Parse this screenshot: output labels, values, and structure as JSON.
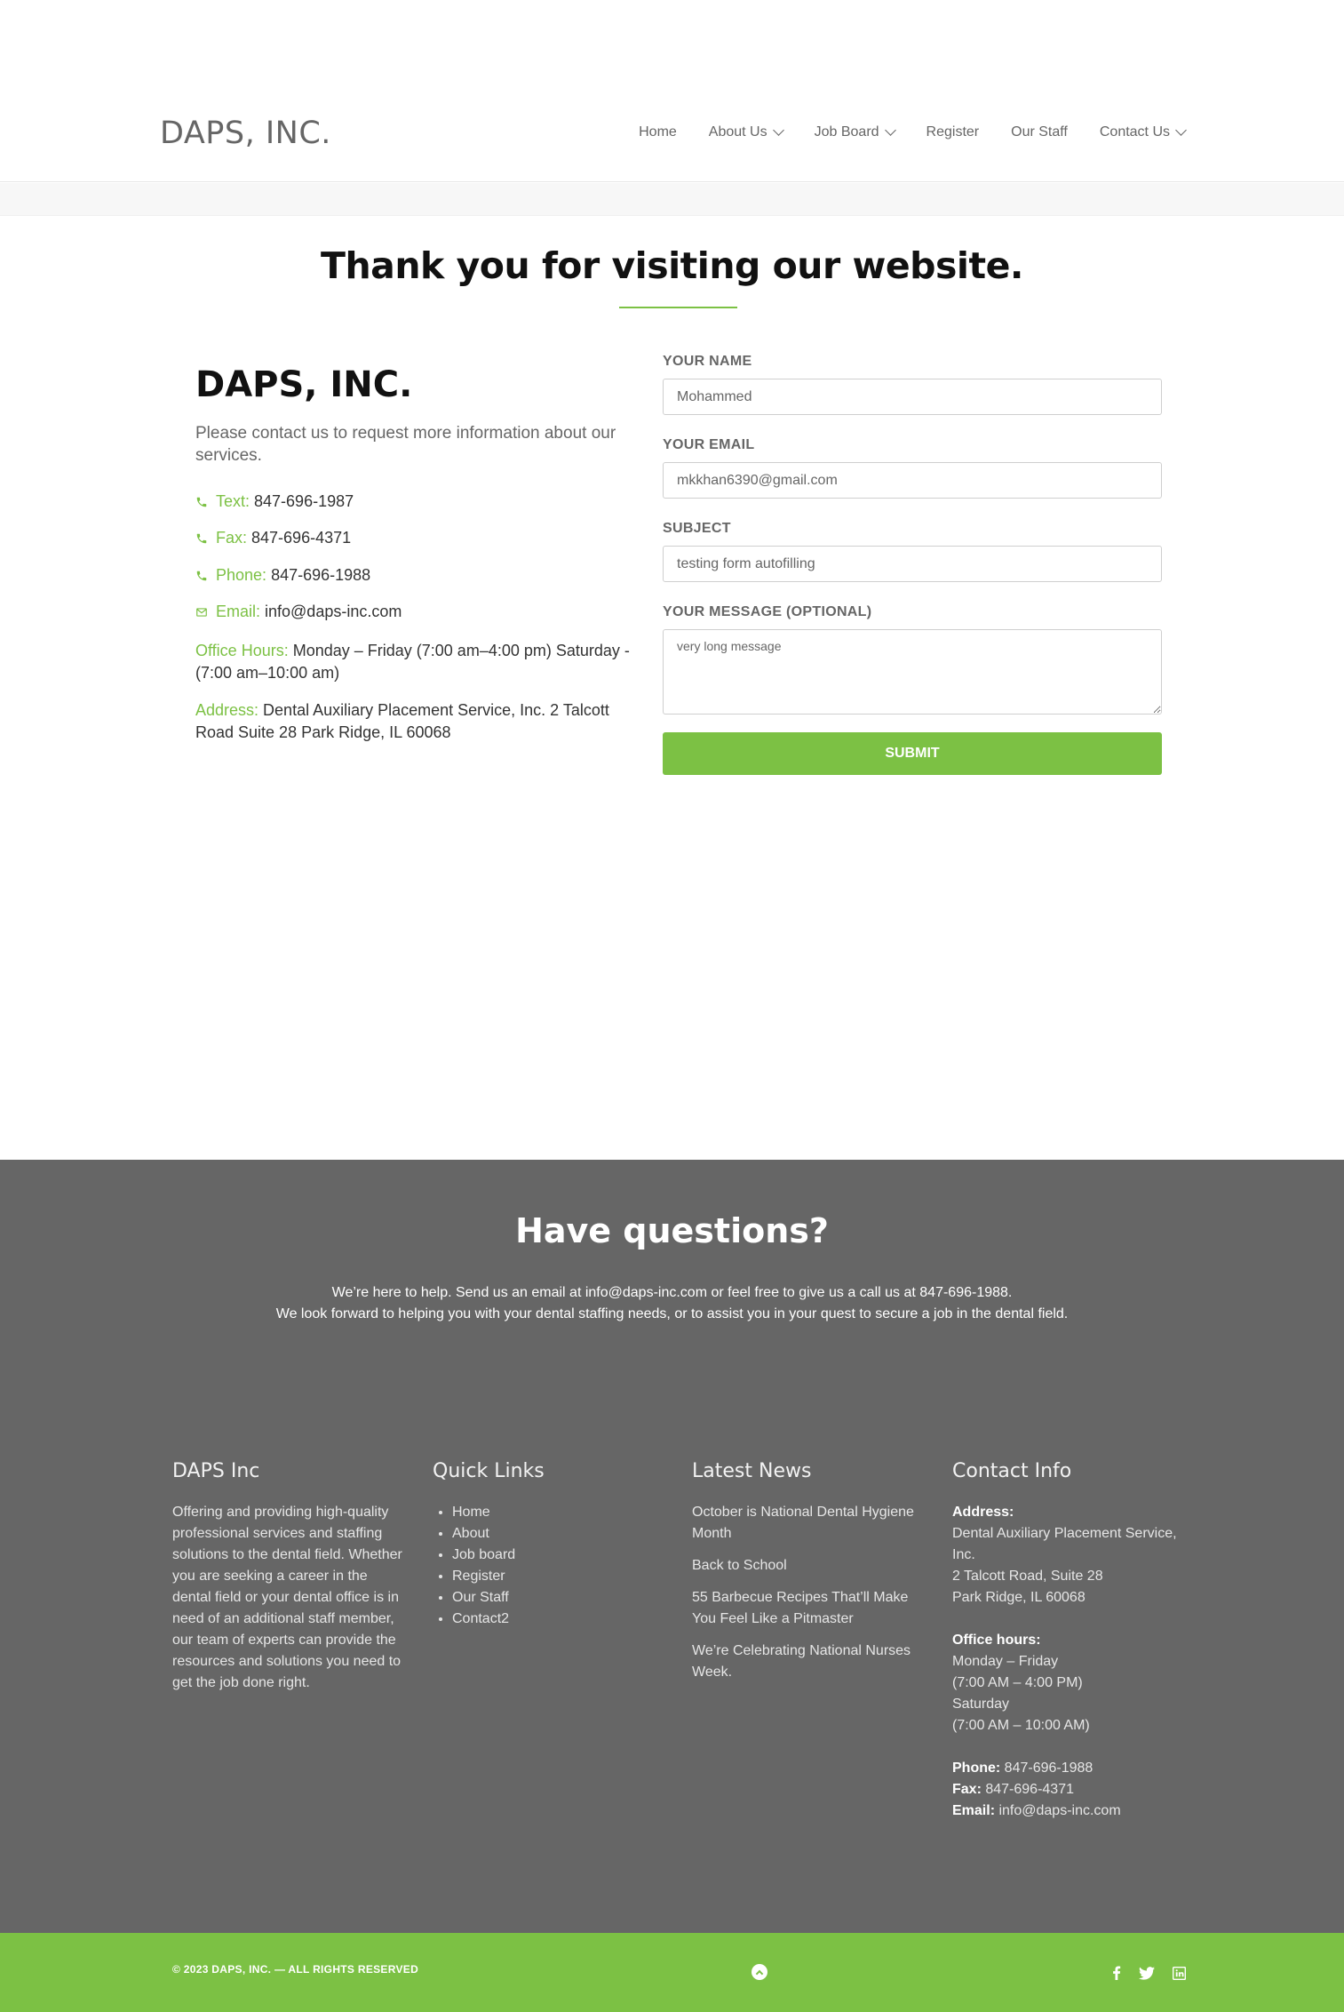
{
  "header": {
    "logo": "DAPS, INC.",
    "nav": [
      {
        "label": "Home"
      },
      {
        "label": "About Us"
      },
      {
        "label": "Job Board"
      },
      {
        "label": "Register"
      },
      {
        "label": "Our Staff"
      },
      {
        "label": "Contact Us"
      }
    ]
  },
  "main": {
    "heading": "Thank you for visiting our website.",
    "company": "DAPS, INC.",
    "intro": "Please contact us to request more information about our services.",
    "contacts": {
      "text_label": "Text:",
      "text_value": "847-696-1987",
      "fax_label": "Fax:",
      "fax_value": "847-696-4371",
      "phone_label": "Phone:",
      "phone_value": "847-696-1988",
      "email_label": "Email:",
      "email_value": "info@daps-inc.com",
      "hours_label": "Office Hours:",
      "hours_value": "Monday – Friday (7:00 am–4:00 pm) Saturday - (7:00 am–10:00 am)",
      "address_label": "Address:",
      "address_value": "Dental Auxiliary Placement Service, Inc. 2 Talcott Road Suite 28 Park Ridge, IL 60068"
    },
    "accent_color": "#7cc144"
  },
  "form": {
    "name_label": "YOUR NAME",
    "name_value": "Mohammed",
    "email_label": "YOUR EMAIL",
    "email_value": "mkkhan6390@gmail.com",
    "subject_label": "SUBJECT",
    "subject_value": "testing form autofilling",
    "message_label": "YOUR MESSAGE (OPTIONAL)",
    "message_value": "very long message",
    "submit_label": "SUBMIT"
  },
  "questions": {
    "title": "Have questions?",
    "line1": "We’re here to help. Send us an email at info@daps-inc.com or feel free to give us a call us at 847-696-1988.",
    "line2": "We look forward to helping you with your dental staffing needs, or to assist you in your quest to secure a job in the dental field."
  },
  "footer": {
    "about": {
      "title": "DAPS Inc",
      "text": "Offering and providing high-quality professional services and staffing solutions to the dental field. Whether you are seeking a career in the dental field or your dental office is in need of an additional staff member, our team of experts can provide the resources and solutions you need to get the job done right."
    },
    "links": {
      "title": "Quick Links",
      "items": [
        "Home",
        "About",
        "Job board",
        "Register",
        "Our Staff",
        "Contact2"
      ]
    },
    "news": {
      "title": "Latest News",
      "items": [
        "October is National Dental Hygiene Month",
        "Back to School",
        "55 Barbecue Recipes That’ll Make You Feel Like a Pitmaster",
        "We’re Celebrating National Nurses Week."
      ]
    },
    "contact": {
      "title": "Contact Info",
      "address_label": "Address:",
      "address_lines": [
        "Dental Auxiliary Placement Service, Inc.",
        "2 Talcott Road, Suite 28",
        "Park Ridge, IL 60068"
      ],
      "hours_label": "Office hours:",
      "hours_lines": [
        "Monday – Friday",
        "(7:00 AM – 4:00 PM)",
        "Saturday",
        "(7:00 AM – 10:00 AM)"
      ],
      "phone_label": "Phone:",
      "phone_value": "847-696-1988",
      "fax_label": "Fax:",
      "fax_value": "847-696-4371",
      "email_label": "Email:",
      "email_value": "info@daps-inc.com"
    },
    "copyright": "© 2023 DAPS, INC. — ALL RIGHTS RESERVED",
    "social_icons": [
      "facebook-icon",
      "twitter-icon",
      "linkedin-icon"
    ]
  }
}
